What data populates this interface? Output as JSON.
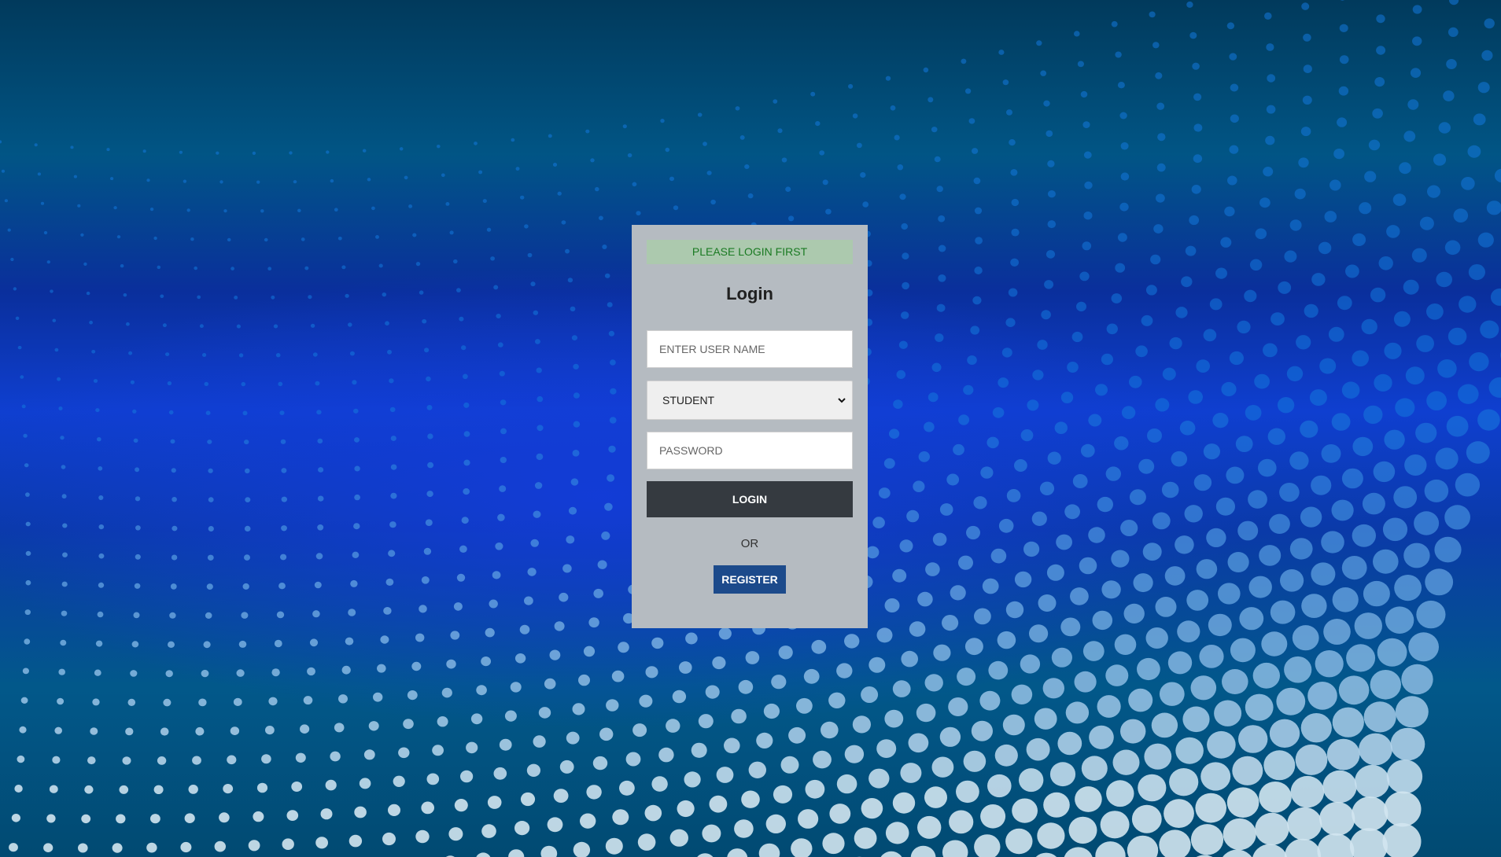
{
  "alert": {
    "text": "PLEASE LOGIN FIRST"
  },
  "form": {
    "title": "Login",
    "username_placeholder": "ENTER USER NAME",
    "role_selected": "STUDENT",
    "password_placeholder": "PASSWORD",
    "login_label": "LOGIN",
    "or_text": "OR",
    "register_label": "REGISTER"
  },
  "icons": {
    "select_arrow": "chevron-down-icon"
  },
  "colors": {
    "card_bg": "#b5bbc1",
    "alert_bg": "#acc9ae",
    "alert_text": "#1a7a22",
    "login_button": "#353a40",
    "register_button": "#1c4a8b"
  }
}
